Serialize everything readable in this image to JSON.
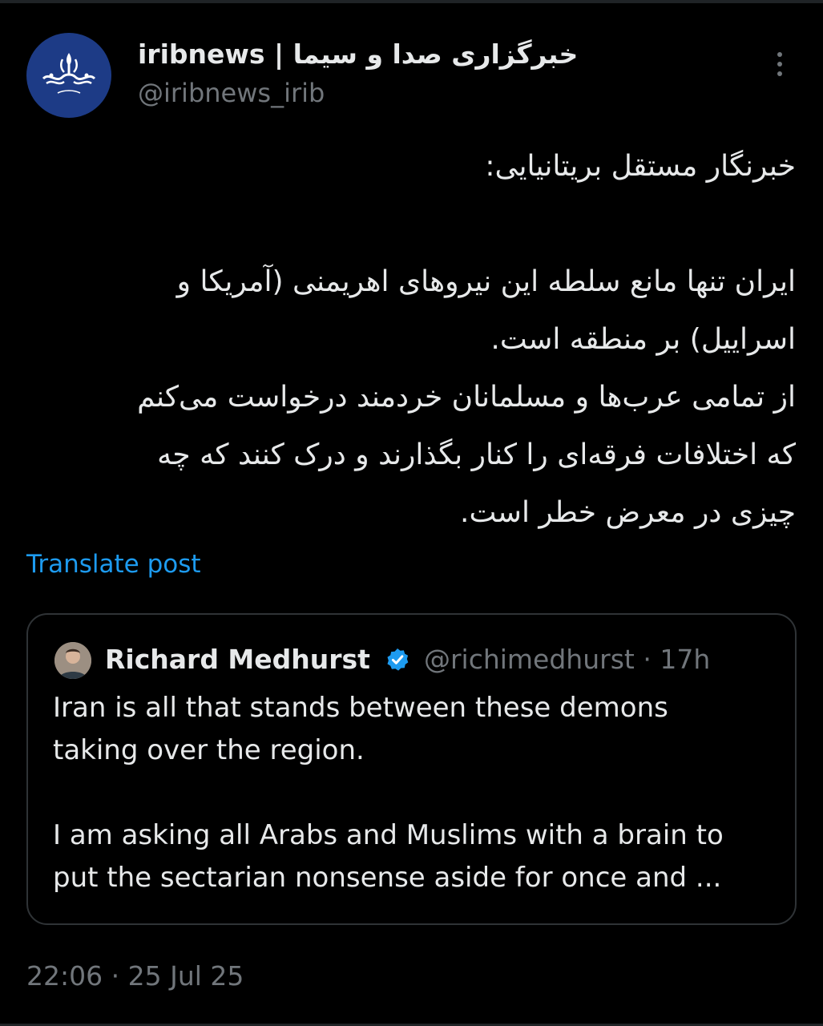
{
  "header": {
    "display_name": "iribnews | خبرگزاری صدا و سیما",
    "handle": "@iribnews_irib",
    "avatar_label": "خبرگزاری صدا و سیما"
  },
  "post": {
    "lines": [
      "خبرنگار مستقل بریتانیایی:",
      "",
      "ایران تنها مانع سلطه این نیروهای اهریمنی (آمریکا و",
      "اسراییل) بر منطقه است.",
      "از تمامی عرب‌ها و مسلمانان خردمند درخواست می‌کنم",
      "که اختلافات فرقه‌ای را کنار بگذارند و درک کنند که چه",
      "چیزی در معرض خطر است."
    ],
    "translate_label": "Translate post"
  },
  "quote": {
    "name": "Richard Medhurst",
    "handle": "@richimedhurst",
    "separator": "·",
    "time": "17h",
    "lines": [
      "Iran is all that stands between these demons",
      "taking over the region.",
      "",
      "I am asking all Arabs and Muslims with a brain to",
      "put the sectarian nonsense aside for once and ..."
    ]
  },
  "timestamp": {
    "time": "22:06",
    "separator": "·",
    "date": "25 Jul 25"
  },
  "colors": {
    "background": "#000000",
    "text": "#e7e9ea",
    "muted": "#71767b",
    "link": "#1d9bf0",
    "border": "#2f3336",
    "avatar_bg": "#1d3b86",
    "verified": "#1d9bf0"
  },
  "icons": {
    "more": "more-vertical-icon",
    "verified": "verified-badge-icon"
  }
}
